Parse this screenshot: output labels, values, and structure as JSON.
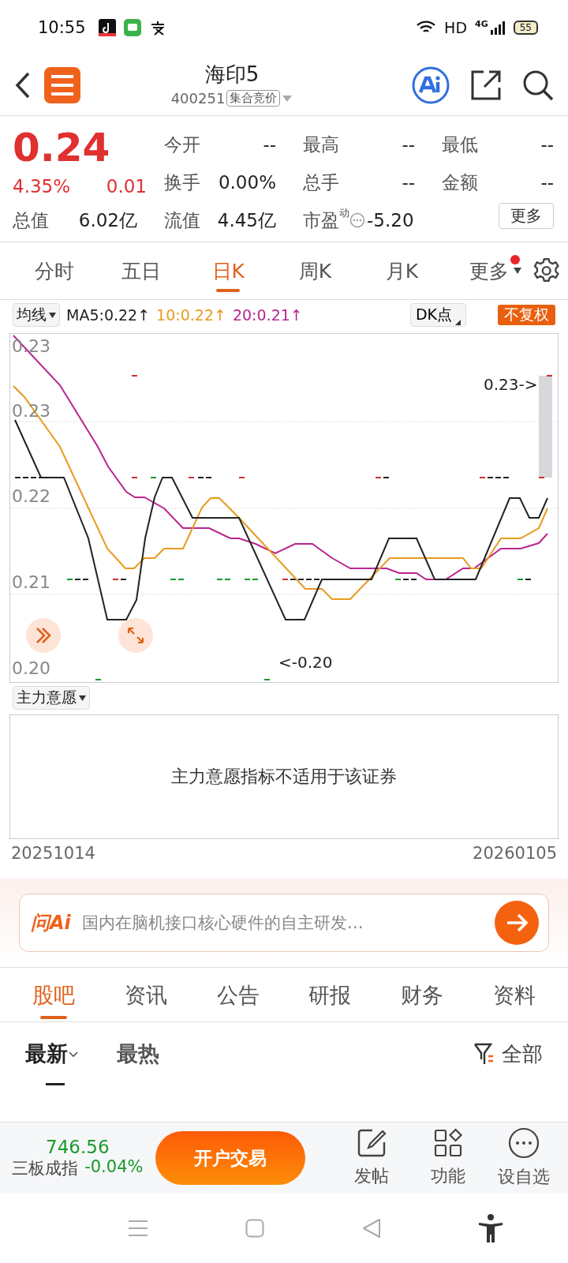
{
  "status_bar": {
    "time": "10:55",
    "hd": "HD",
    "network": "4G",
    "battery": "55"
  },
  "header": {
    "title": "海印5",
    "code": "400251",
    "badge": "集合竞价"
  },
  "quote": {
    "price": "0.24",
    "change_pct": "4.35%",
    "change": "0.01",
    "fields": [
      {
        "label": "今开",
        "value": "--"
      },
      {
        "label": "最高",
        "value": "--"
      },
      {
        "label": "最低",
        "value": "--"
      },
      {
        "label": "换手",
        "value": "0.00%"
      },
      {
        "label": "总手",
        "value": "--"
      },
      {
        "label": "金额",
        "value": "--"
      },
      {
        "label": "总值",
        "value": "6.02亿"
      },
      {
        "label": "流值",
        "value": "4.45亿"
      },
      {
        "label": "市盈",
        "sup": "动",
        "value": "-5.20"
      }
    ],
    "more_button": "更多"
  },
  "period_tabs": [
    {
      "label": "分时",
      "selected": false,
      "notification": false
    },
    {
      "label": "五日",
      "selected": false,
      "notification": false
    },
    {
      "label": "日K",
      "selected": true,
      "notification": false
    },
    {
      "label": "周K",
      "selected": false,
      "notification": false
    },
    {
      "label": "月K",
      "selected": false,
      "notification": false
    },
    {
      "label": "更多",
      "selected": false,
      "notification": true
    }
  ],
  "chart": {
    "indicator": "均线",
    "ma_labels": [
      {
        "text": "MA5:0.22↑",
        "color": "#222222"
      },
      {
        "text": "10:0.22↑",
        "color": "#e89a1c"
      },
      {
        "text": "20:0.21↑",
        "color": "#b8258e"
      }
    ],
    "dk_button": "DK点",
    "adjust_badge": "不复权",
    "y_labels": [
      "0.23",
      "0.23",
      "0.22",
      "0.21",
      "0.20"
    ],
    "max_label": "0.23->",
    "min_label": "<-0.20"
  },
  "indicator_panel": {
    "dropdown": "主力意愿",
    "message": "主力意愿指标不适用于该证券",
    "date_start": "20251014",
    "date_end": "20260105"
  },
  "ai_bar": {
    "logo": "问Ai",
    "prompt": "国内在脑机接口核心硬件的自主研发…"
  },
  "content_tabs": [
    {
      "label": "股吧",
      "selected": true
    },
    {
      "label": "资讯",
      "selected": false
    },
    {
      "label": "公告",
      "selected": false
    },
    {
      "label": "研报",
      "selected": false
    },
    {
      "label": "财务",
      "selected": false
    },
    {
      "label": "资料",
      "selected": false
    }
  ],
  "sort_tabs": [
    {
      "label": "最新",
      "selected": true
    },
    {
      "label": "最热",
      "selected": false
    }
  ],
  "filter": "全部",
  "bottom_bar": {
    "index_value": "746.56",
    "index_name": "三板成指",
    "index_change": "-0.04%",
    "trade_button": "开户交易",
    "actions": [
      {
        "kind": "post",
        "label": "发帖"
      },
      {
        "kind": "functions",
        "label": "功能"
      },
      {
        "kind": "watchlist",
        "label": "设自选"
      }
    ]
  }
}
